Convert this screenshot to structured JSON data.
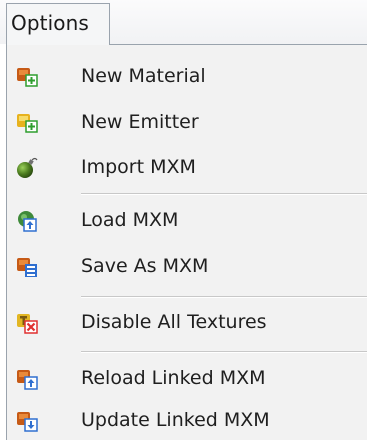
{
  "menubar": {
    "options_label": "Options"
  },
  "menu": {
    "items": [
      {
        "label": "New Material",
        "icon": "new-material-icon"
      },
      {
        "label": "New Emitter",
        "icon": "new-emitter-icon"
      },
      {
        "label": "Import MXM",
        "icon": "import-bomb-icon"
      },
      {
        "label": "Load MXM",
        "icon": "load-icon"
      },
      {
        "label": "Save As MXM",
        "icon": "save-as-icon"
      },
      {
        "label": "Disable All Textures",
        "icon": "disable-textures-icon"
      },
      {
        "label": "Reload Linked MXM",
        "icon": "reload-linked-icon"
      },
      {
        "label": "Update Linked MXM",
        "icon": "update-linked-icon"
      }
    ]
  },
  "colors": {
    "material_orange": "#d2691e",
    "emitter_yellow": "#f0c030",
    "add_green": "#2e9e2e",
    "blue_badge": "#2f6fd0",
    "red_badge": "#e03030"
  }
}
